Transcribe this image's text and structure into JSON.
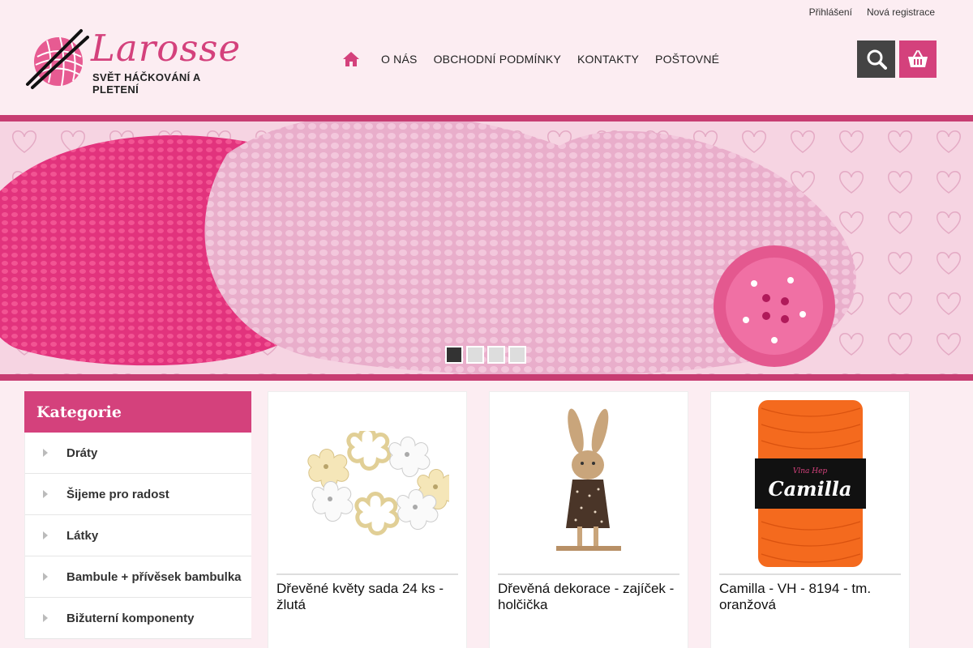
{
  "top_links": {
    "login": "Přihlášení",
    "register": "Nová registrace"
  },
  "logo": {
    "name": "Larosse",
    "tagline": "SVĚT HÁČKOVÁNÍ A PLETENÍ"
  },
  "nav": {
    "items": [
      "O NÁS",
      "OBCHODNÍ PODMÍNKY",
      "KONTAKTY",
      "POŠTOVNÉ"
    ]
  },
  "icons": {
    "home": "home-icon",
    "search": "search-icon",
    "cart": "basket-icon"
  },
  "colors": {
    "accent": "#d4417c",
    "dark": "#444444",
    "background": "#fcedf2"
  },
  "slider": {
    "slide_count": 4,
    "active_slide": 1
  },
  "sidebar": {
    "title": "Kategorie",
    "items": [
      "Dráty",
      "Šijeme pro radost",
      "Látky",
      "Bambule + přívěsek bambulka",
      "Bižuterní komponenty"
    ]
  },
  "products": [
    {
      "name": "Dřevěné květy sada 24 ks - žlutá"
    },
    {
      "name": "Dřevěná dekorace - zajíček - holčička"
    },
    {
      "name": "Camilla - VH - 8194 - tm. oranžová",
      "label": "Camilla",
      "brand": "Vlna Hep"
    }
  ]
}
